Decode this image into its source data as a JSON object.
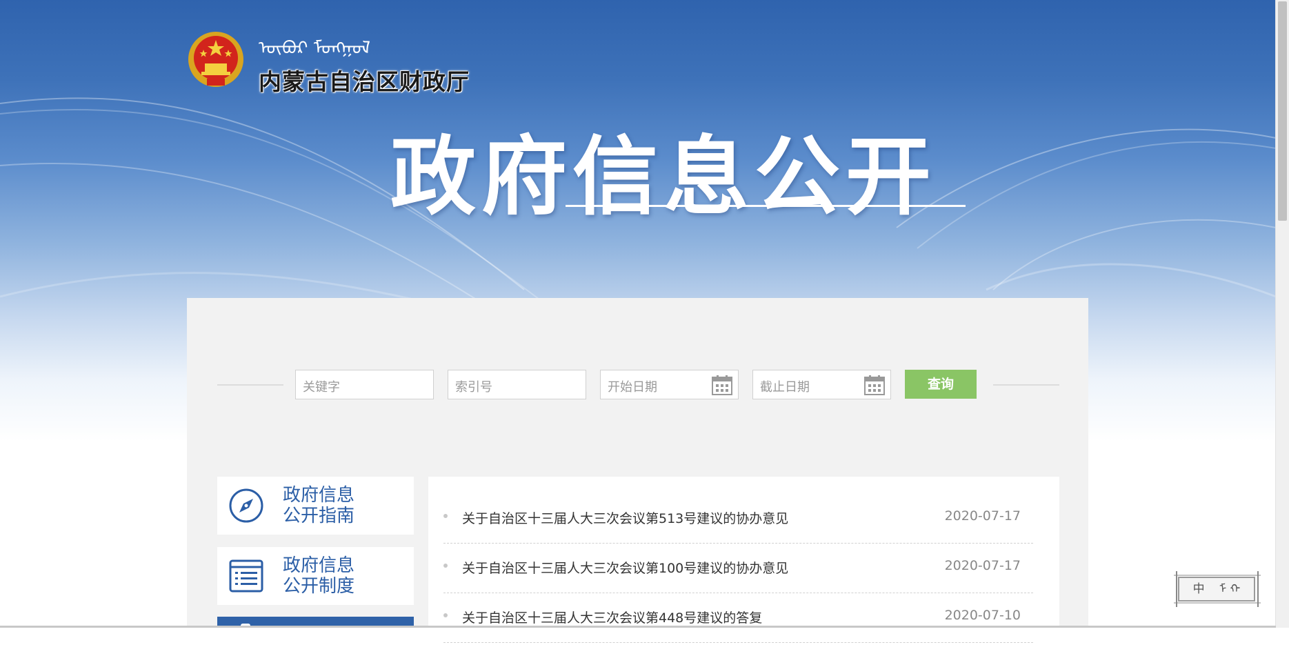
{
  "header": {
    "mongolian_title": "ᠦᠪᠦᠷ ᠮᠣᠩᠭᠣᠯ",
    "department": "内蒙古自治区财政厅",
    "page_title": "政府信息公开"
  },
  "search": {
    "keyword_placeholder": "关键字",
    "index_placeholder": "索引号",
    "start_date_placeholder": "开始日期",
    "end_date_placeholder": "截止日期",
    "query_button": "查询"
  },
  "sidebar": {
    "items": [
      {
        "line1": "政府信息",
        "line2": "公开指南",
        "icon": "compass-icon"
      },
      {
        "line1": "政府信息",
        "line2": "公开制度",
        "icon": "list-document-icon"
      },
      {
        "line1": "",
        "line2": "",
        "icon": "document-icon"
      }
    ]
  },
  "news": {
    "items": [
      {
        "title": "关于自治区十三届人大三次会议第513号建议的协办意见",
        "date": "2020-07-17"
      },
      {
        "title": "关于自治区十三届人大三次会议第100号建议的协办意见",
        "date": "2020-07-17"
      },
      {
        "title": "关于自治区十三届人大三次会议第448号建议的答复",
        "date": "2020-07-10"
      }
    ]
  },
  "language_widget": {
    "label": "中 ᠮ ᠬ"
  },
  "colors": {
    "accent_blue": "#2b5ea6",
    "query_green": "#8ac565",
    "panel_gray": "#f2f2f2"
  }
}
